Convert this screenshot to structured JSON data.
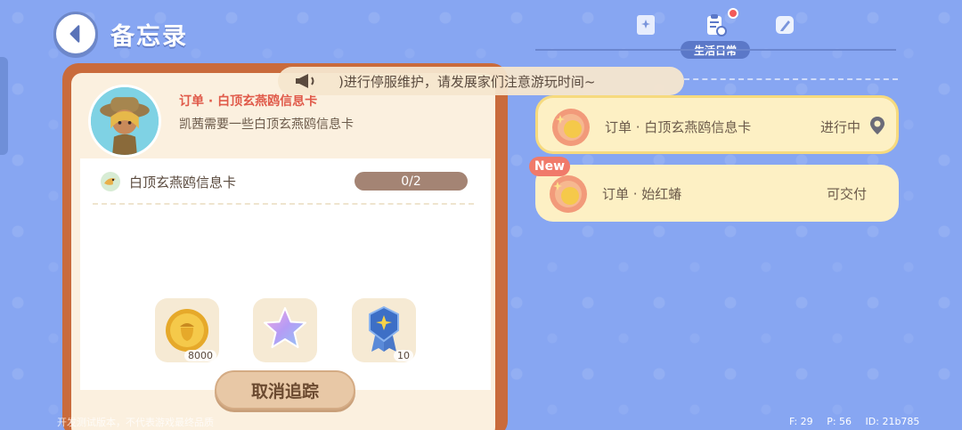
{
  "header": {
    "title": "备忘录"
  },
  "tabs": {
    "active_label": "生活日常"
  },
  "announcement": {
    "text": ")进行停服维护，请发展家们注意游玩时间~"
  },
  "order_detail": {
    "title": "订单 · 白顶玄燕鸥信息卡",
    "description": "凯茜需要一些白顶玄燕鸥信息卡",
    "requirement": {
      "name": "白顶玄燕鸥信息卡",
      "progress": "0/2"
    },
    "rewards": [
      {
        "icon": "acorn-coin-icon",
        "count": "8000"
      },
      {
        "icon": "star-icon",
        "count": ""
      },
      {
        "icon": "medal-badge-icon",
        "count": "10"
      }
    ],
    "cancel_button": "取消追踪"
  },
  "orders": [
    {
      "name": "订单 · 白顶玄燕鸥信息卡",
      "status": "进行中",
      "selected": true
    },
    {
      "name": "订单 · 始红蝽",
      "status": "可交付",
      "badge": "New"
    }
  ],
  "footer": {
    "notice": "开发测试版本，不代表游戏最终品质",
    "stats": {
      "f": "F: 29",
      "p": "P: 56",
      "id": "ID: 21b785"
    }
  },
  "colors": {
    "background": "#87a6f2",
    "panel_frame": "#c96b3c",
    "order_card": "#fdf0c4",
    "order_title_red": "#e05a4a"
  }
}
